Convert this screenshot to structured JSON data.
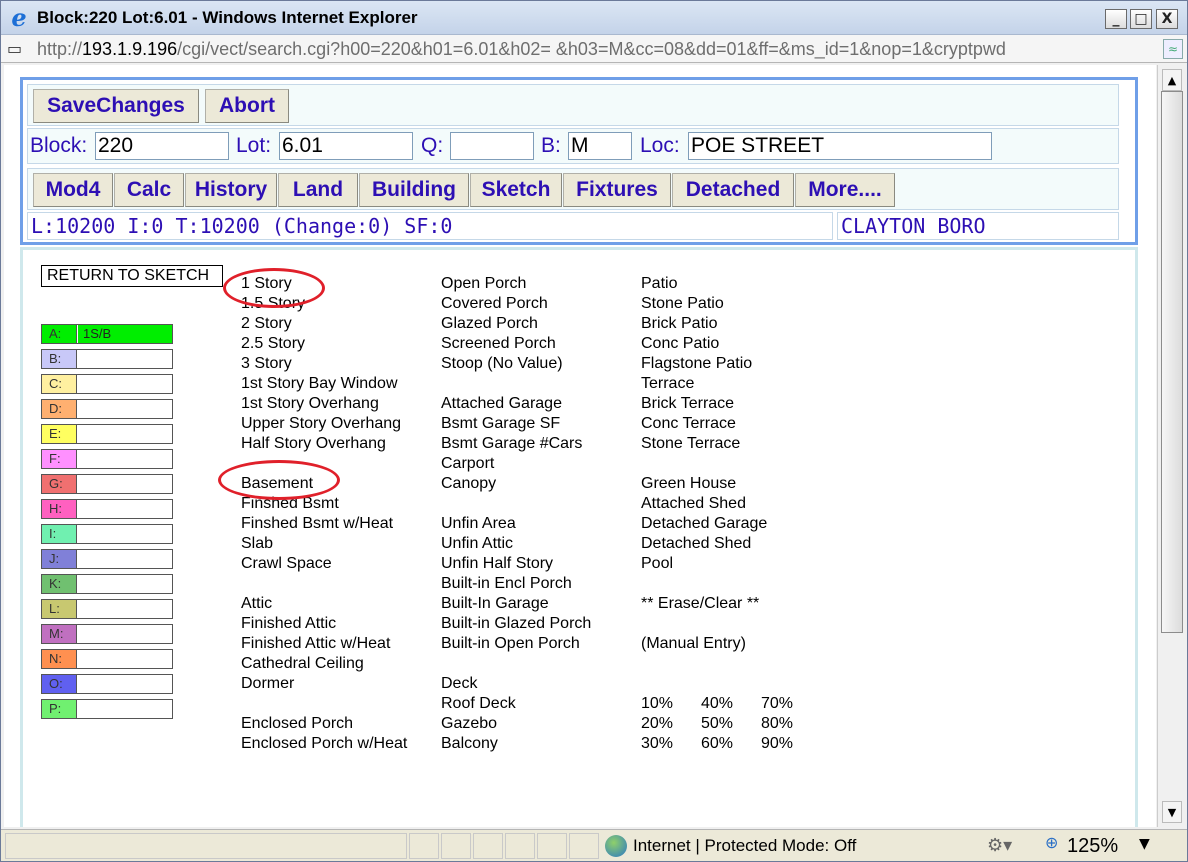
{
  "window": {
    "title": "Block:220 Lot:6.01 - Windows Internet Explorer",
    "minimize": "_",
    "maximize": "□",
    "close": "X"
  },
  "address": {
    "scheme": "http://",
    "host": "193.1.9.196",
    "path": "/cgi/vect/search.cgi?h00=220&h01=6.01&h02= &h03=M&cc=08&dd=01&ff=&ms_id=1&nop=1&cryptpwd"
  },
  "toolbar1": {
    "save": "SaveChanges",
    "abort": "Abort"
  },
  "fields": {
    "block_label": "Block:",
    "block_value": "220",
    "lot_label": "Lot:",
    "lot_value": "6.01",
    "q_label": "Q:",
    "q_value": "",
    "b_label": "B:",
    "b_value": "M",
    "loc_label": "Loc:",
    "loc_value": "POE STREET"
  },
  "nav": [
    "Mod4",
    "Calc",
    "History",
    "Land",
    "Building",
    "Sketch",
    "Fixtures",
    "Detached",
    "More...."
  ],
  "summary": {
    "values": "L:10200 I:0 T:10200 (Change:0) SF:0",
    "town": "CLAYTON BORO"
  },
  "return_label": "RETURN TO SKETCH",
  "slots": [
    {
      "key": "A:",
      "value": "1S/B",
      "color": "#00ee00"
    },
    {
      "key": "B:",
      "value": "",
      "color": "#c8c8f8"
    },
    {
      "key": "C:",
      "value": "",
      "color": "#fff0a0"
    },
    {
      "key": "D:",
      "value": "",
      "color": "#ffb070"
    },
    {
      "key": "E:",
      "value": "",
      "color": "#ffff60"
    },
    {
      "key": "F:",
      "value": "",
      "color": "#ff90ff"
    },
    {
      "key": "G:",
      "value": "",
      "color": "#f07070"
    },
    {
      "key": "H:",
      "value": "",
      "color": "#ff60c0"
    },
    {
      "key": "I:",
      "value": "",
      "color": "#70f0b0"
    },
    {
      "key": "J:",
      "value": "",
      "color": "#8080d8"
    },
    {
      "key": "K:",
      "value": "",
      "color": "#70c070"
    },
    {
      "key": "L:",
      "value": "",
      "color": "#c8c870"
    },
    {
      "key": "M:",
      "value": "",
      "color": "#c070c0"
    },
    {
      "key": "N:",
      "value": "",
      "color": "#ff9050"
    },
    {
      "key": "O:",
      "value": "",
      "color": "#6060f0"
    },
    {
      "key": "P:",
      "value": "",
      "color": "#70f070"
    }
  ],
  "col1": [
    "1 Story",
    "1.5 Story",
    "2 Story",
    "2.5 Story",
    "3 Story",
    "1st Story Bay Window",
    "1st Story Overhang",
    "Upper Story Overhang",
    "Half Story Overhang",
    "",
    "Basement",
    "Finshed Bsmt",
    "Finshed Bsmt w/Heat",
    "Slab",
    "Crawl Space",
    "",
    "Attic",
    "Finished Attic",
    "Finished Attic w/Heat",
    "Cathedral Ceiling",
    "Dormer",
    "",
    "Enclosed Porch",
    "Enclosed Porch w/Heat"
  ],
  "col2": [
    "Open Porch",
    "Covered Porch",
    "Glazed Porch",
    "Screened Porch",
    "Stoop (No Value)",
    "",
    "Attached Garage",
    "Bsmt Garage SF",
    "Bsmt Garage #Cars",
    "Carport",
    "Canopy",
    "",
    "Unfin Area",
    "Unfin Attic",
    "Unfin Half Story",
    "Built-in Encl Porch",
    "Built-In Garage",
    "Built-in Glazed Porch",
    "Built-in Open Porch",
    "",
    "Deck",
    "Roof Deck",
    "Gazebo",
    "Balcony"
  ],
  "col3": [
    "Patio",
    "Stone Patio",
    "Brick Patio",
    "Conc Patio",
    "Flagstone Patio",
    "Terrace",
    "Brick Terrace",
    "Conc Terrace",
    "Stone Terrace",
    "",
    "Green House",
    "Attached Shed",
    "Detached Garage",
    "Detached Shed",
    "Pool",
    "",
    "** Erase/Clear **",
    "",
    "(Manual Entry)",
    "",
    "",
    "",
    "",
    ""
  ],
  "percents": [
    [
      "10%",
      "40%",
      "70%"
    ],
    [
      "20%",
      "50%",
      "80%"
    ],
    [
      "30%",
      "60%",
      "90%"
    ]
  ],
  "status": {
    "zone": "Internet | Protected Mode: Off",
    "zoom": "125%"
  },
  "scroll": {
    "up": "▲",
    "down": "▼"
  }
}
